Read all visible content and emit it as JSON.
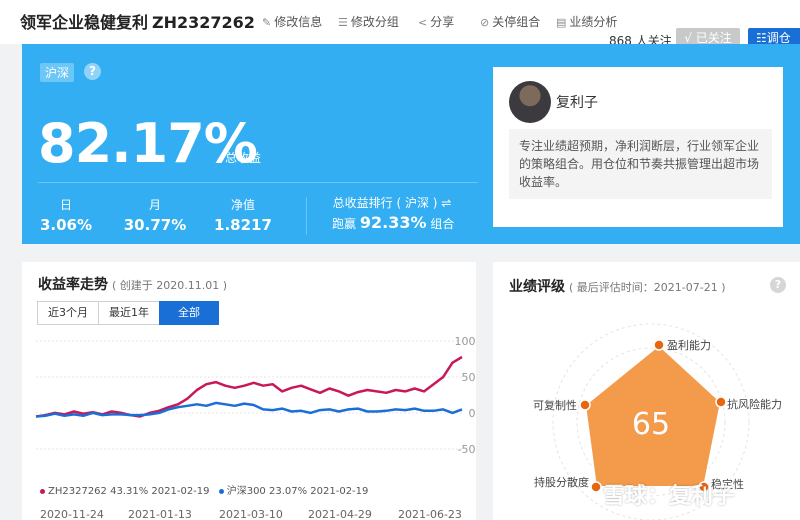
{
  "header": {
    "title": "领军企业稳健复利",
    "code": "ZH2327262",
    "actions": [
      {
        "icon": "pencil-icon",
        "glyph": "✎",
        "label": "修改信息"
      },
      {
        "icon": "list-icon",
        "glyph": "☰",
        "label": "修改分组"
      },
      {
        "icon": "share-icon",
        "glyph": "<",
        "label": "分享"
      },
      {
        "icon": "block-icon",
        "glyph": "⊘",
        "label": "关停组合"
      },
      {
        "icon": "report-icon",
        "glyph": "▤",
        "label": "业绩分析"
      }
    ],
    "follow_count": "868 人关注",
    "followed_label": "√ 已关注",
    "rebalance_label": "☷调仓"
  },
  "hero": {
    "market_tag": "沪深",
    "total_return": "82.17%",
    "total_return_label": "总收益",
    "stats": [
      {
        "label": "日",
        "value": "3.06%"
      },
      {
        "label": "月",
        "value": "30.77%"
      },
      {
        "label": "净值",
        "value": "1.8217"
      }
    ],
    "rank_label": "总收益排行 ( 沪深 ) ⇌",
    "rank_prefix": "跑赢",
    "rank_value": "92.33%",
    "rank_suffix": "组合"
  },
  "owner": {
    "name": "复利子",
    "description": "专注业绩超预期，净利润断层，行业领军企业的策略组合。用仓位和节奏共振管理出超市场收益率。"
  },
  "trend": {
    "title": "收益率走势",
    "subtitle": "( 创建于 2020.11.01 )",
    "ranges": [
      "近3个月",
      "最近1年",
      "全部"
    ],
    "active_range": "全部",
    "legend": [
      {
        "name": "ZH2327262 43.31% 2021-02-19",
        "color": "#c8185a"
      },
      {
        "name": "沪深300 23.07% 2021-02-19",
        "color": "#1a6fd6"
      }
    ]
  },
  "chart_data": {
    "type": "line",
    "y_tick_labels": [
      "100%",
      "50%",
      "0%",
      "-50%"
    ],
    "x_tick_labels": [
      "2020-11-24",
      "2021-01-13",
      "2021-03-10",
      "2021-04-29",
      "2021-06-23"
    ],
    "ylim": [
      -60,
      110
    ],
    "x_count": 46,
    "series": [
      {
        "name": "ZH2327262",
        "color": "#c8185a",
        "values": [
          -5,
          -3,
          0,
          -2,
          2,
          -1,
          1,
          -2,
          2,
          0,
          -3,
          -5,
          0,
          3,
          8,
          12,
          20,
          32,
          40,
          43,
          38,
          35,
          38,
          42,
          38,
          40,
          30,
          35,
          38,
          33,
          28,
          34,
          30,
          24,
          29,
          32,
          30,
          28,
          32,
          30,
          34,
          30,
          40,
          50,
          70,
          78
        ]
      },
      {
        "name": "沪深300",
        "color": "#1a6fd6",
        "values": [
          -5,
          -4,
          -1,
          -4,
          -2,
          -4,
          0,
          -3,
          -2,
          -2,
          -3,
          -3,
          -2,
          0,
          5,
          8,
          10,
          12,
          10,
          14,
          12,
          10,
          13,
          11,
          5,
          4,
          6,
          2,
          3,
          0,
          4,
          5,
          2,
          5,
          6,
          2,
          2,
          3,
          5,
          4,
          6,
          3,
          3,
          5,
          0,
          5
        ]
      }
    ]
  },
  "rating": {
    "title": "业绩评级",
    "subtitle": "( 最后评估时间：2021-07-21 )",
    "score": "65",
    "labels": [
      "盈利能力",
      "抗风险能力",
      "稳定性",
      "持股分散度",
      "可复制性"
    ]
  },
  "watermark": "雪球：复利子"
}
